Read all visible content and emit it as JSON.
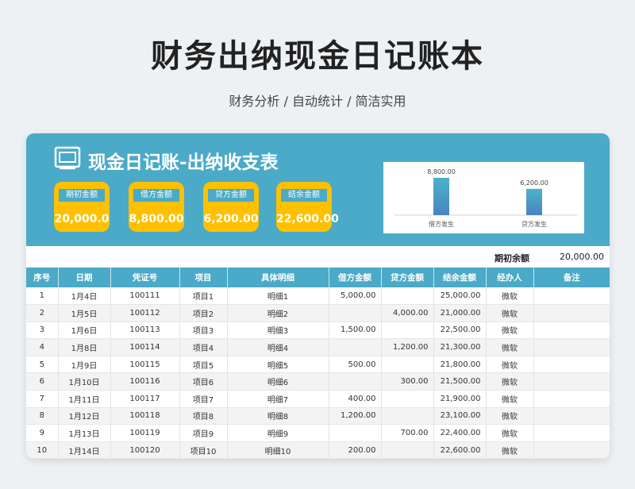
{
  "header": {
    "title": "财务出纳现金日记账本",
    "subtitle": "财务分析 / 自动统计 / 简洁实用"
  },
  "banner": {
    "title": "现金日记账-出纳收支表",
    "icon": "document-icon"
  },
  "kpis": [
    {
      "label": "期初金额",
      "value": "20,000.0"
    },
    {
      "label": "借方金额",
      "value": "8,800.00"
    },
    {
      "label": "贷方金额",
      "value": "6,200.00"
    },
    {
      "label": "结余金额",
      "value": "22,600.00"
    }
  ],
  "chart_data": {
    "type": "bar",
    "categories": [
      "借方发生",
      "贷方发生"
    ],
    "values": [
      8800,
      6200
    ],
    "value_labels": [
      "8,800.00",
      "6,200.00"
    ],
    "ylim": [
      0,
      10000
    ],
    "grid": false,
    "title": "",
    "xlabel": "",
    "ylabel": ""
  },
  "opening": {
    "label": "期初余额",
    "value": "20,000.00"
  },
  "colors": {
    "banner": "#4aaac7",
    "kpi": "#ffc000",
    "bar_top": "#4bb3c8",
    "bar_bottom": "#4a82c4"
  },
  "table": {
    "columns": [
      "序号",
      "日期",
      "凭证号",
      "项目",
      "具体明细",
      "借方金额",
      "贷方金额",
      "结余金额",
      "经办人",
      "备注"
    ],
    "rows": [
      [
        "1",
        "1月4日",
        "100111",
        "项目1",
        "明细1",
        "5,000.00",
        "",
        "25,000.00",
        "微软",
        ""
      ],
      [
        "2",
        "1月5日",
        "100112",
        "项目2",
        "明细2",
        "",
        "4,000.00",
        "21,000.00",
        "微软",
        ""
      ],
      [
        "3",
        "1月6日",
        "100113",
        "项目3",
        "明细3",
        "1,500.00",
        "",
        "22,500.00",
        "微软",
        ""
      ],
      [
        "4",
        "1月8日",
        "100114",
        "项目4",
        "明细4",
        "",
        "1,200.00",
        "21,300.00",
        "微软",
        ""
      ],
      [
        "5",
        "1月9日",
        "100115",
        "项目5",
        "明细5",
        "500.00",
        "",
        "21,800.00",
        "微软",
        ""
      ],
      [
        "6",
        "1月10日",
        "100116",
        "项目6",
        "明细6",
        "",
        "300.00",
        "21,500.00",
        "微软",
        ""
      ],
      [
        "7",
        "1月11日",
        "100117",
        "项目7",
        "明细7",
        "400.00",
        "",
        "21,900.00",
        "微软",
        ""
      ],
      [
        "8",
        "1月12日",
        "100118",
        "项目8",
        "明细8",
        "1,200.00",
        "",
        "23,100.00",
        "微软",
        ""
      ],
      [
        "9",
        "1月13日",
        "100119",
        "项目9",
        "明细9",
        "",
        "700.00",
        "22,400.00",
        "微软",
        ""
      ],
      [
        "10",
        "1月14日",
        "100120",
        "项目10",
        "明细10",
        "200.00",
        "",
        "22,600.00",
        "微软",
        ""
      ]
    ]
  }
}
